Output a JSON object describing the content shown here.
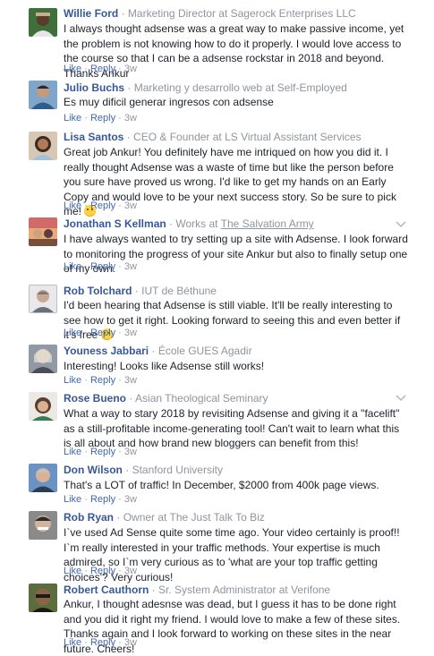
{
  "separator": "·",
  "actions": {
    "like": "Like",
    "reply": "Reply"
  },
  "comments": [
    {
      "name": "Willie Ford",
      "role": "Marketing Director at Sagerock Enterprises LLC",
      "text": "I always thought adsense was a great way to make passive income, yet the problem is not knowing how to do it properly. I would love access to the course so that I can be a adsense rockstar in 2018 and beyond. Thanks Ankur",
      "time": "3w",
      "avatar_colors": [
        "#3f6f3a",
        "#c8b088",
        "#2a2a2a"
      ]
    },
    {
      "name": "Julio Buchs",
      "role": "Marketing y desarrollo web at Self-Employed",
      "text": "Es muy dificil generar ingresos con adsense",
      "time": "3w",
      "avatar_colors": [
        "#2f5d8c",
        "#c89a7a",
        "#1e2b3a"
      ]
    },
    {
      "name": "Lisa Santos",
      "role": "CEO & Founder at LS Virtual Assistant Services",
      "text": "Great job Ankur! You definitely have me intriqued on how you did it. I really thought Adsense was a waste of time but like the person before you sure have proved us wrong. I'd like to get my hands on an Early Copy and would love to be your next success story. So be sure to pick me!",
      "time": "3w",
      "has_emoji": true,
      "avatar_colors": [
        "#d9c7b6",
        "#b07a58",
        "#3b2a22"
      ]
    },
    {
      "name": "Jonathan S Kellman",
      "role_prefix": "Works at",
      "role_link": "The Salvation Army",
      "text": "I have always wanted to try setting up a site with Adsense. I look forward to monitoring the progress of your site Ankur but also to finally setup one of my own.",
      "time": "3w",
      "avatar_colors": [
        "#d36a6a",
        "#caa37c",
        "#5a3d3d"
      ]
    },
    {
      "name": "Rob Tolchard",
      "role": "IUT de Béthune",
      "text": "I'd been hearing that Adsense is still viable. It'll be really interesting to see how to get it right. Looking forward to seeing this and even better if it's free",
      "time": "3w",
      "has_emoji": true,
      "avatar_colors": [
        "#e9e9ea",
        "#c8a890",
        "#7a7a7a"
      ]
    },
    {
      "name": "Youness Jabbari",
      "role": "École GUES Agadir",
      "text": "Interesting! Looks like Adsense still works!",
      "time": "3w",
      "avatar_colors": [
        "#8f9aa5",
        "#d8c4b0",
        "#4a4f57"
      ]
    },
    {
      "name": "Rose Bueno",
      "role": "Asian Theological Seminary",
      "text": "What a way to stary 2018 by revisiting Adsense and giving it a \"facelift\" as a still-profitable income-generating tool! Can't wait to learn what this is all about and how brand new bloggers can benefit from this!",
      "time": "3w",
      "avatar_colors": [
        "#ece9e4",
        "#d7b294",
        "#5c3e30"
      ]
    },
    {
      "name": "Don Wilson",
      "role": "Stanford University",
      "text": "That's a LOT of traffic! In December, $2000 from 400k page views.",
      "time": "3w",
      "avatar_colors": [
        "#6a93c4",
        "#d8b296",
        "#2c3e55"
      ]
    },
    {
      "name": "Rob Ryan",
      "role": "Owner at The Just Talk To Biz",
      "text": "I`ve used Ad Sense quite some time ago. Your video certainly is proof!! I`m really interested in your traffic methods. Your expertise is much admired, so I`m very curious as to 'what are your top traffic getting choices'? Very curious!",
      "time": "3w",
      "avatar_colors": [
        "#8a8a8a",
        "#d0b49c",
        "#2b2b2b"
      ]
    },
    {
      "name": "Robert Cauthorn",
      "role": "Sr. System Administrator at Verifone",
      "text": "Ankur, I thought adesnse was dead, but I guess it has to be done right and you did it right my friend. I would love to make a few of these sites. Thanks again and I look forward to working on these sites in the near future. Cheers!",
      "time": "3w",
      "avatar_colors": [
        "#5b6d3c",
        "#8a6448",
        "#1a1a1a"
      ]
    }
  ]
}
